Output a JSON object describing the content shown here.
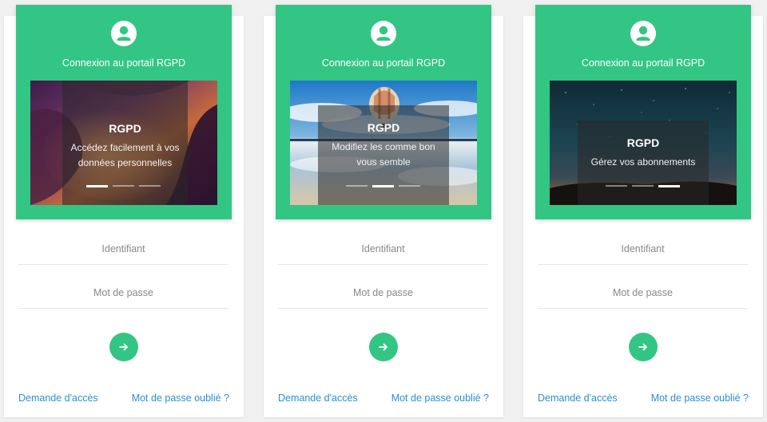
{
  "colors": {
    "accent": "#33c584",
    "link": "#2a8fd6",
    "placeholder": "#888888"
  },
  "cards": [
    {
      "header_title": "Connexion au portail RGPD",
      "avatar_icon": "user-circle-icon",
      "slide": {
        "title": "RGPD",
        "text": "Accédez facilement à vos\ndonnées personnelles",
        "active_index": 0,
        "total": 3
      },
      "login_placeholder": "Identifiant",
      "password_placeholder": "Mot de passe",
      "submit_icon": "arrow-right-icon",
      "access_link": "Demande d'accès",
      "forgot_link": "Mot de passe oublié ?"
    },
    {
      "header_title": "Connexion au portail RGPD",
      "avatar_icon": "user-circle-icon",
      "slide": {
        "title": "RGPD",
        "text": "Modifiez les comme bon\nvous semble",
        "active_index": 1,
        "total": 3
      },
      "login_placeholder": "Identifiant",
      "password_placeholder": "Mot de passe",
      "submit_icon": "arrow-right-icon",
      "access_link": "Demande d'accès",
      "forgot_link": "Mot de passe oublié ?"
    },
    {
      "header_title": "Connexion au portail RGPD",
      "avatar_icon": "user-circle-icon",
      "slide": {
        "title": "RGPD",
        "text": "Gérez vos abonnements",
        "active_index": 2,
        "total": 3
      },
      "login_placeholder": "Identifiant",
      "password_placeholder": "Mot de passe",
      "submit_icon": "arrow-right-icon",
      "access_link": "Demande d'accès",
      "forgot_link": "Mot de passe oublié ?"
    }
  ]
}
